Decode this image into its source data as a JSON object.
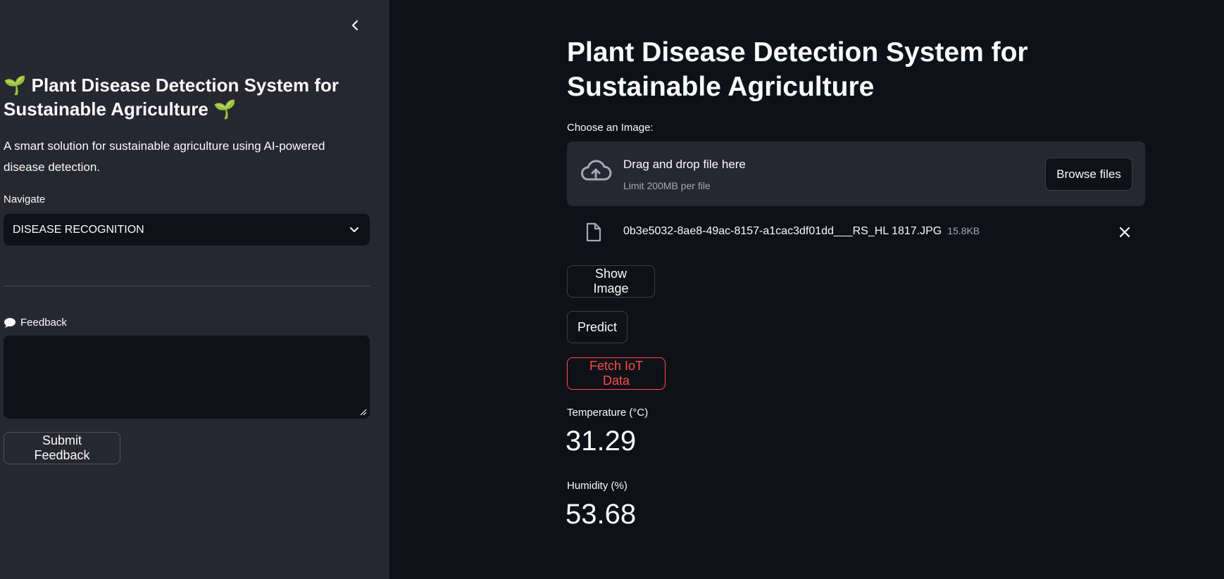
{
  "sidebar": {
    "title": "🌱 Plant Disease Detection System for Sustainable Agriculture 🌱",
    "description": "A smart solution for sustainable agriculture using AI-powered disease detection.",
    "navigate_label": "Navigate",
    "navigate_value": "DISEASE RECOGNITION",
    "feedback_label": "Feedback",
    "feedback_value": "",
    "submit_label": "Submit Feedback"
  },
  "main": {
    "title": "Plant Disease Detection System for Sustainable Agriculture",
    "upload_label": "Choose an Image:",
    "dropzone_title": "Drag and drop file here",
    "dropzone_limit": "Limit 200MB per file",
    "browse_label": "Browse files",
    "file": {
      "name": "0b3e5032-8ae8-49ac-8157-a1cac3df01dd___RS_HL 1817.JPG",
      "size": "15.8KB"
    },
    "show_image_label": "Show Image",
    "predict_label": "Predict",
    "fetch_iot_label": "Fetch IoT Data",
    "temperature": {
      "label": "Temperature (°C)",
      "value": "31.29"
    },
    "humidity": {
      "label": "Humidity (%)",
      "value": "53.68"
    }
  },
  "icons": {
    "collapse": "chevron-left-icon",
    "select": "chevron-down-icon",
    "feedback": "speech-bubble-icon",
    "upload": "cloud-upload-icon",
    "file": "file-icon",
    "remove": "close-icon"
  },
  "colors": {
    "background": "#0e1117",
    "sidebar": "#262730",
    "accent": "#ff4b4b"
  }
}
